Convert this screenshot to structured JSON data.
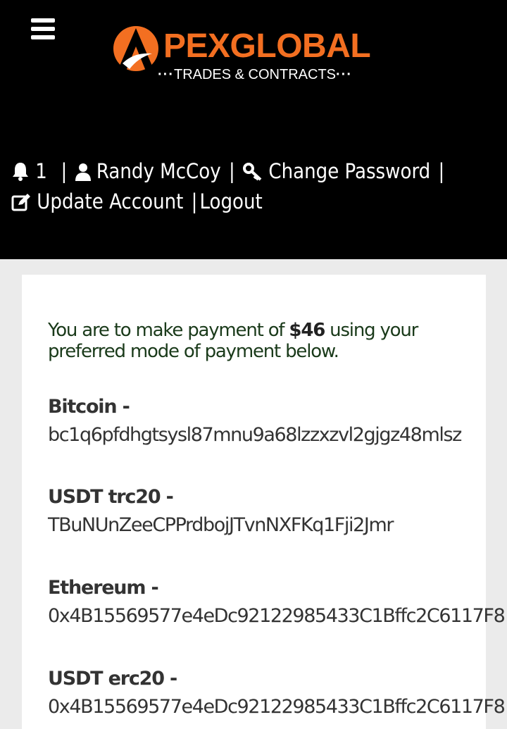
{
  "header": {
    "logo_wordmark": "PEXGLOBAL",
    "logo_tagline": "TRADES & CONTRACTS",
    "colors": {
      "brand": "#f36f21",
      "background": "#000000"
    }
  },
  "nav": {
    "notifications_count": "1",
    "user_name": "Randy McCoy",
    "change_password": "Change Password",
    "update_account": "Update Account",
    "logout": "Logout",
    "icons": [
      "menu-icon",
      "bell-icon",
      "user-icon",
      "key-icon",
      "edit-icon"
    ]
  },
  "payment": {
    "intro_before": "You are to make payment of ",
    "amount": "$46",
    "intro_after": " using your preferred mode of payment below."
  },
  "wallets": [
    {
      "label": "Bitcoin -",
      "address": "bc1q6pfdhgtsysl87mnu9a68lzzxzvl2gjgz48mlsz"
    },
    {
      "label": "USDT trc20 -",
      "address": "TBuNUnZeeCPPrdbojJTvnNXFKq1Fji2Jmr"
    },
    {
      "label": "Ethereum -",
      "address": "0x4B15569577e4eDc92122985433C1Bffc2C6117F8"
    },
    {
      "label": "USDT erc20 -",
      "address": "0x4B15569577e4eDc92122985433C1Bffc2C6117F8"
    }
  ]
}
